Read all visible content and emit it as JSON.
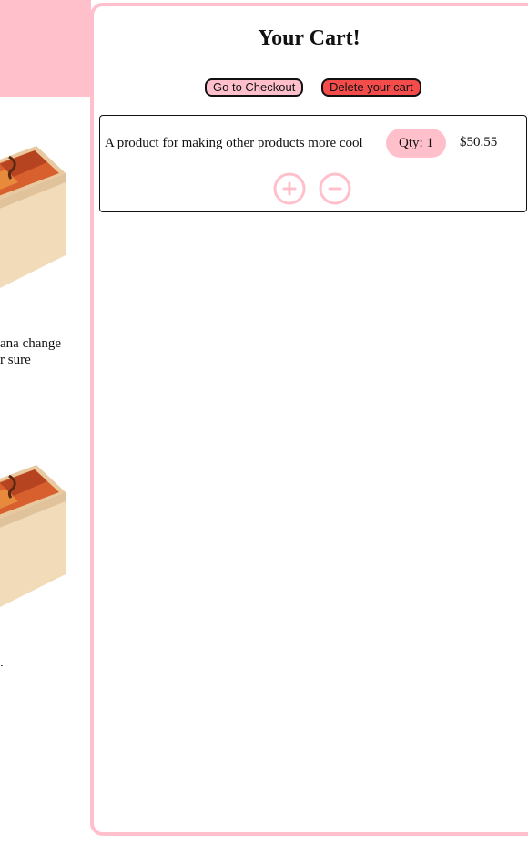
{
  "shop": {
    "products": [
      {
        "description_lines": [
          "ana change",
          "r sure"
        ]
      },
      {
        "description_lines": [
          "",
          "."
        ]
      }
    ]
  },
  "cart": {
    "title": "Your Cart!",
    "checkout_label": "Go to Checkout",
    "delete_label": "Delete your cart",
    "items": [
      {
        "name": "A product for making other products more cool",
        "quantity_label": "Qty: 1",
        "price": "$50.55"
      }
    ]
  },
  "icons": {
    "increase": "plus-circle-icon",
    "decrease": "minus-circle-icon",
    "product": "product-box-image"
  },
  "colors": {
    "accent_pink": "#ffc0cb",
    "delete_red": "#f44b4b",
    "text": "#111111"
  }
}
